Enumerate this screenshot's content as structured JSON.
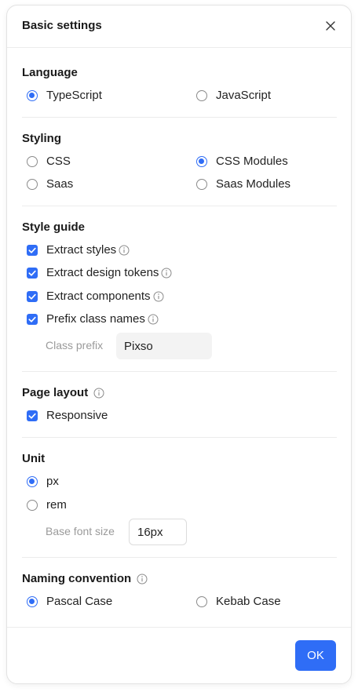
{
  "dialog": {
    "title": "Basic settings",
    "ok_label": "OK"
  },
  "language": {
    "title": "Language",
    "options": [
      {
        "label": "TypeScript",
        "selected": true
      },
      {
        "label": "JavaScript",
        "selected": false
      }
    ]
  },
  "styling": {
    "title": "Styling",
    "options": [
      {
        "label": "CSS",
        "selected": false
      },
      {
        "label": "CSS Modules",
        "selected": true
      },
      {
        "label": "Saas",
        "selected": false
      },
      {
        "label": "Saas Modules",
        "selected": false
      }
    ]
  },
  "style_guide": {
    "title": "Style guide",
    "options": [
      {
        "label": "Extract styles",
        "checked": true
      },
      {
        "label": "Extract design tokens",
        "checked": true
      },
      {
        "label": "Extract components",
        "checked": true
      },
      {
        "label": "Prefix class names",
        "checked": true
      }
    ],
    "class_prefix_label": "Class prefix",
    "class_prefix_value": "Pixso"
  },
  "page_layout": {
    "title": "Page layout",
    "options": [
      {
        "label": "Responsive",
        "checked": true
      }
    ]
  },
  "unit": {
    "title": "Unit",
    "options": [
      {
        "label": "px",
        "selected": true
      },
      {
        "label": "rem",
        "selected": false
      }
    ],
    "base_font_size_label": "Base font size",
    "base_font_size_value": "16px"
  },
  "naming": {
    "title": "Naming convention",
    "options": [
      {
        "label": "Pascal Case",
        "selected": true
      },
      {
        "label": "Kebab Case",
        "selected": false
      }
    ]
  },
  "colors": {
    "accent": "#2f6df6",
    "divider": "#ececec"
  }
}
